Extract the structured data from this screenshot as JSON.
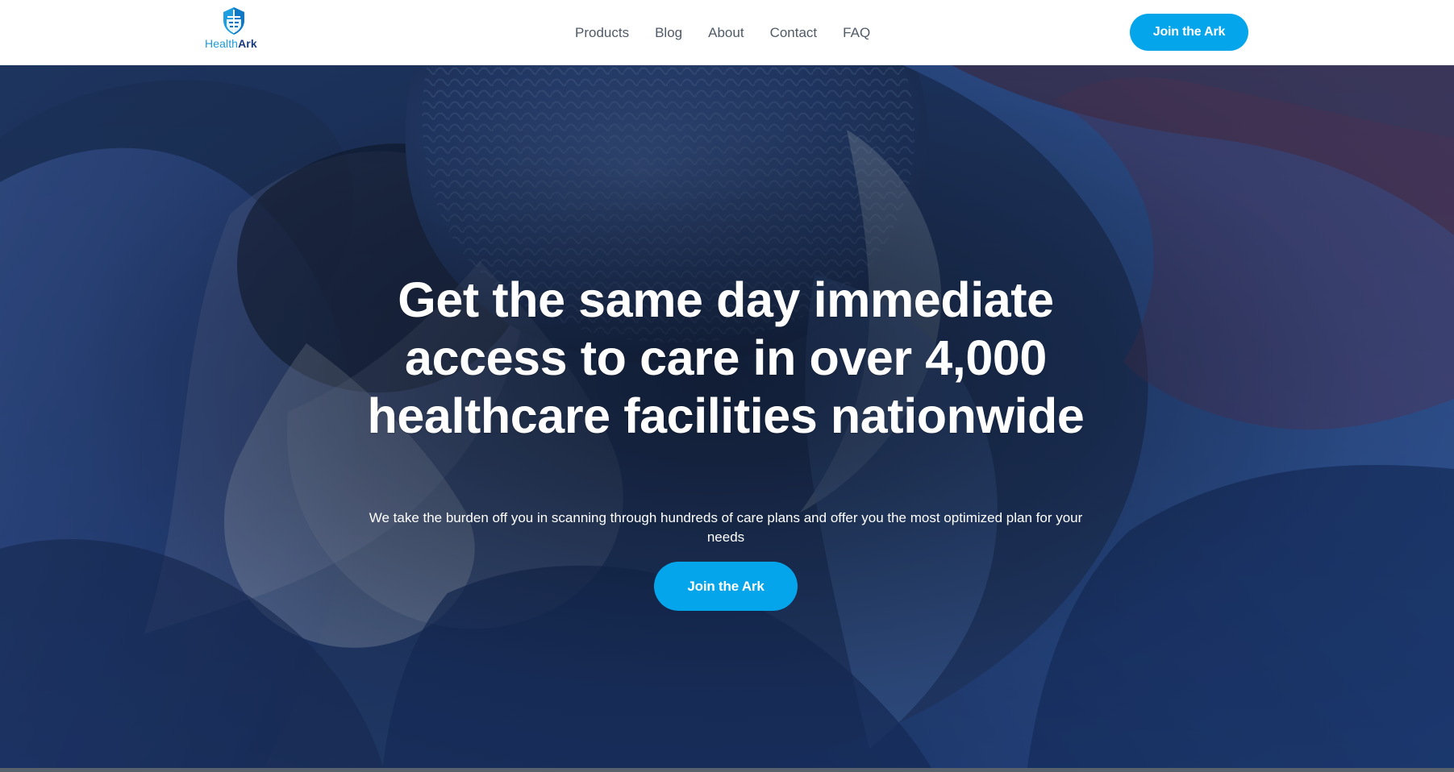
{
  "brand": {
    "name_part1": "Health",
    "name_part2": "Ark",
    "logo_icon": "ark-shield-icon",
    "colors": {
      "primary": "#05a5ec",
      "navy": "#1a3b7c",
      "light_blue": "#1c9bdc"
    }
  },
  "nav": {
    "links": [
      {
        "label": "Products"
      },
      {
        "label": "Blog"
      },
      {
        "label": "About"
      },
      {
        "label": "Contact"
      },
      {
        "label": "FAQ"
      }
    ],
    "cta_label": "Join the Ark"
  },
  "hero": {
    "title": "Get the same day immediate access to care in over 4,000 healthcare facilities nationwide",
    "subtitle": "We take the burden off you in scanning through hundreds of care plans and offer you the most optimized plan for your needs",
    "cta_label": "Join the Ark",
    "background_image": "surgeons-in-operating-room-photo",
    "overlay_color": "#1f3354"
  }
}
